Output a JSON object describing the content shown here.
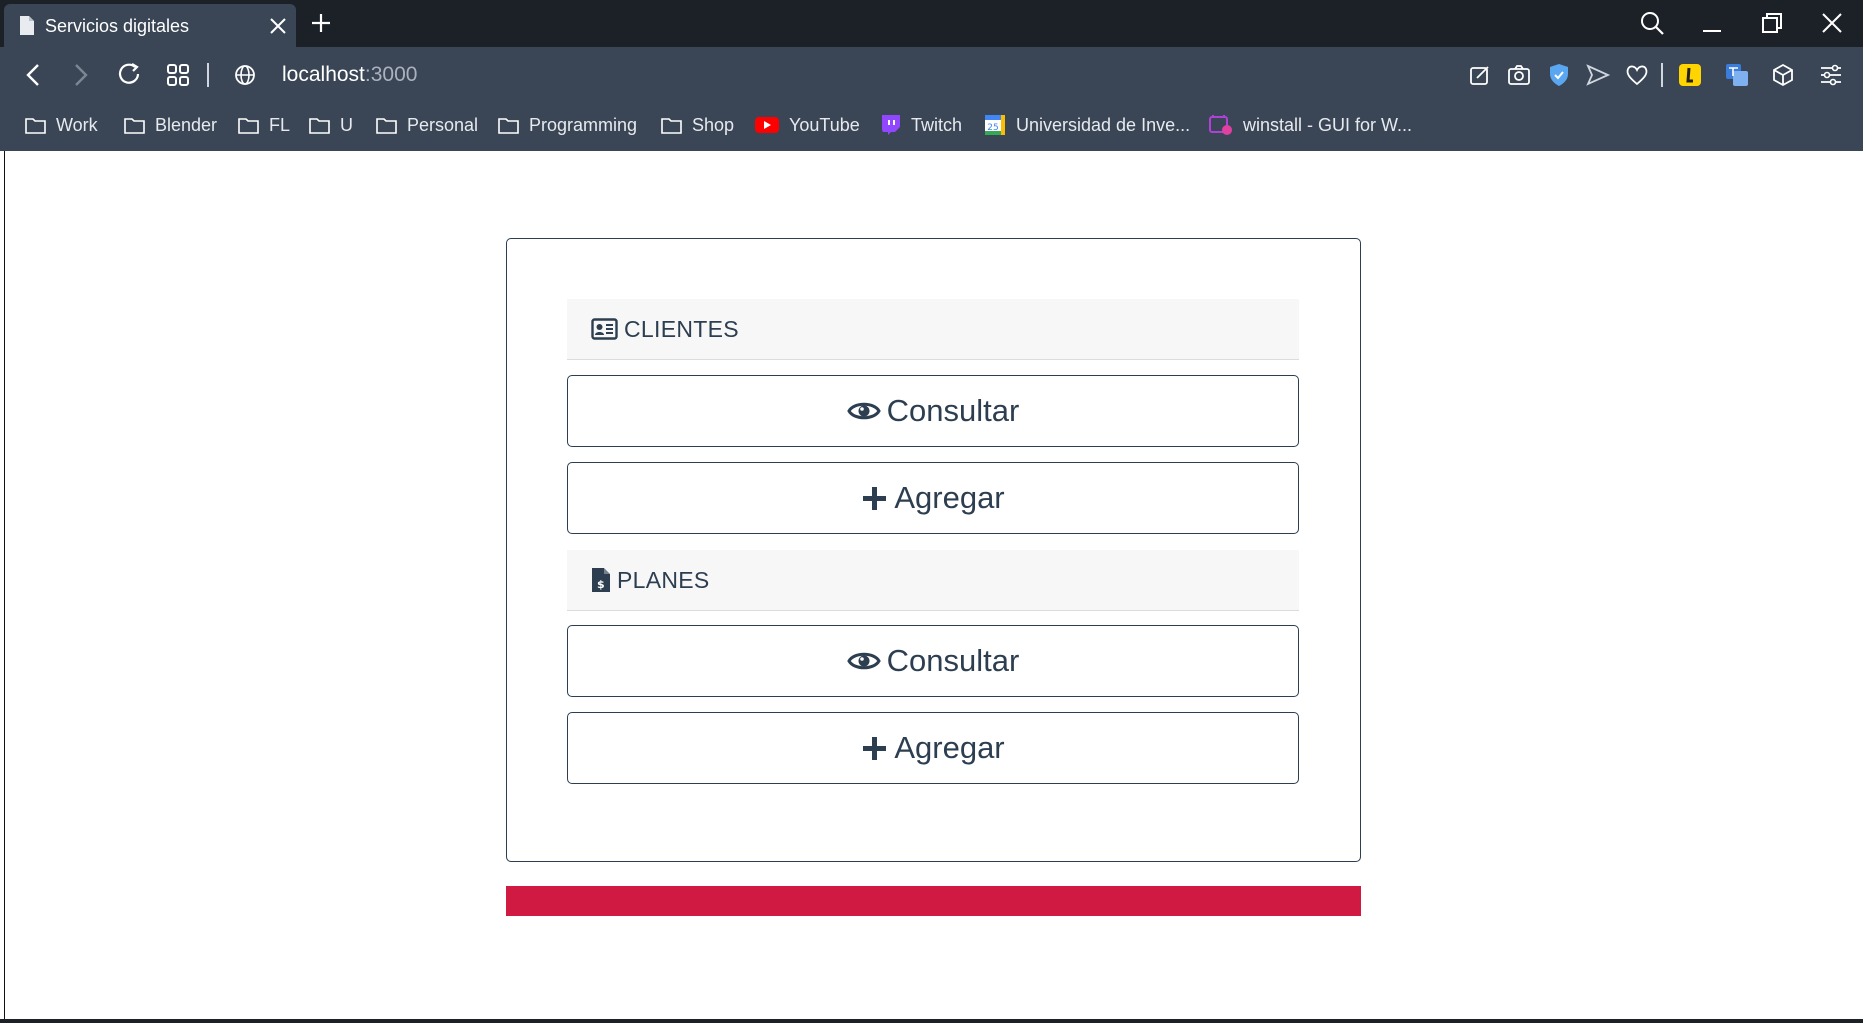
{
  "browser": {
    "tab_title": "Servicios digitales",
    "address_host": "localhost",
    "address_port": ":3000"
  },
  "bookmarks": [
    {
      "label": "Work",
      "icon": "folder-icon"
    },
    {
      "label": "Blender",
      "icon": "folder-icon"
    },
    {
      "label": "FL",
      "icon": "folder-icon"
    },
    {
      "label": "U",
      "icon": "folder-icon"
    },
    {
      "label": "Personal",
      "icon": "folder-icon"
    },
    {
      "label": "Programming",
      "icon": "folder-icon"
    },
    {
      "label": "Shop",
      "icon": "folder-icon"
    },
    {
      "label": "YouTube",
      "icon": "youtube-icon"
    },
    {
      "label": "Twitch",
      "icon": "twitch-icon"
    },
    {
      "label": "Universidad de Inve...",
      "icon": "calendar-icon"
    },
    {
      "label": "winstall - GUI for W...",
      "icon": "winstall-icon"
    }
  ],
  "page": {
    "sections": [
      {
        "title": "CLIENTES",
        "icon": "id-card-icon",
        "consult_label": "Consultar",
        "add_label": "Agregar"
      },
      {
        "title": "PLANES",
        "icon": "invoice-dollar-icon",
        "consult_label": "Consultar",
        "add_label": "Agregar"
      }
    ]
  },
  "colors": {
    "accent_red": "#d11a42",
    "text_dark": "#2c3e50",
    "toolbar_bg": "#3a4655",
    "tabbar_bg": "#1c2128"
  }
}
